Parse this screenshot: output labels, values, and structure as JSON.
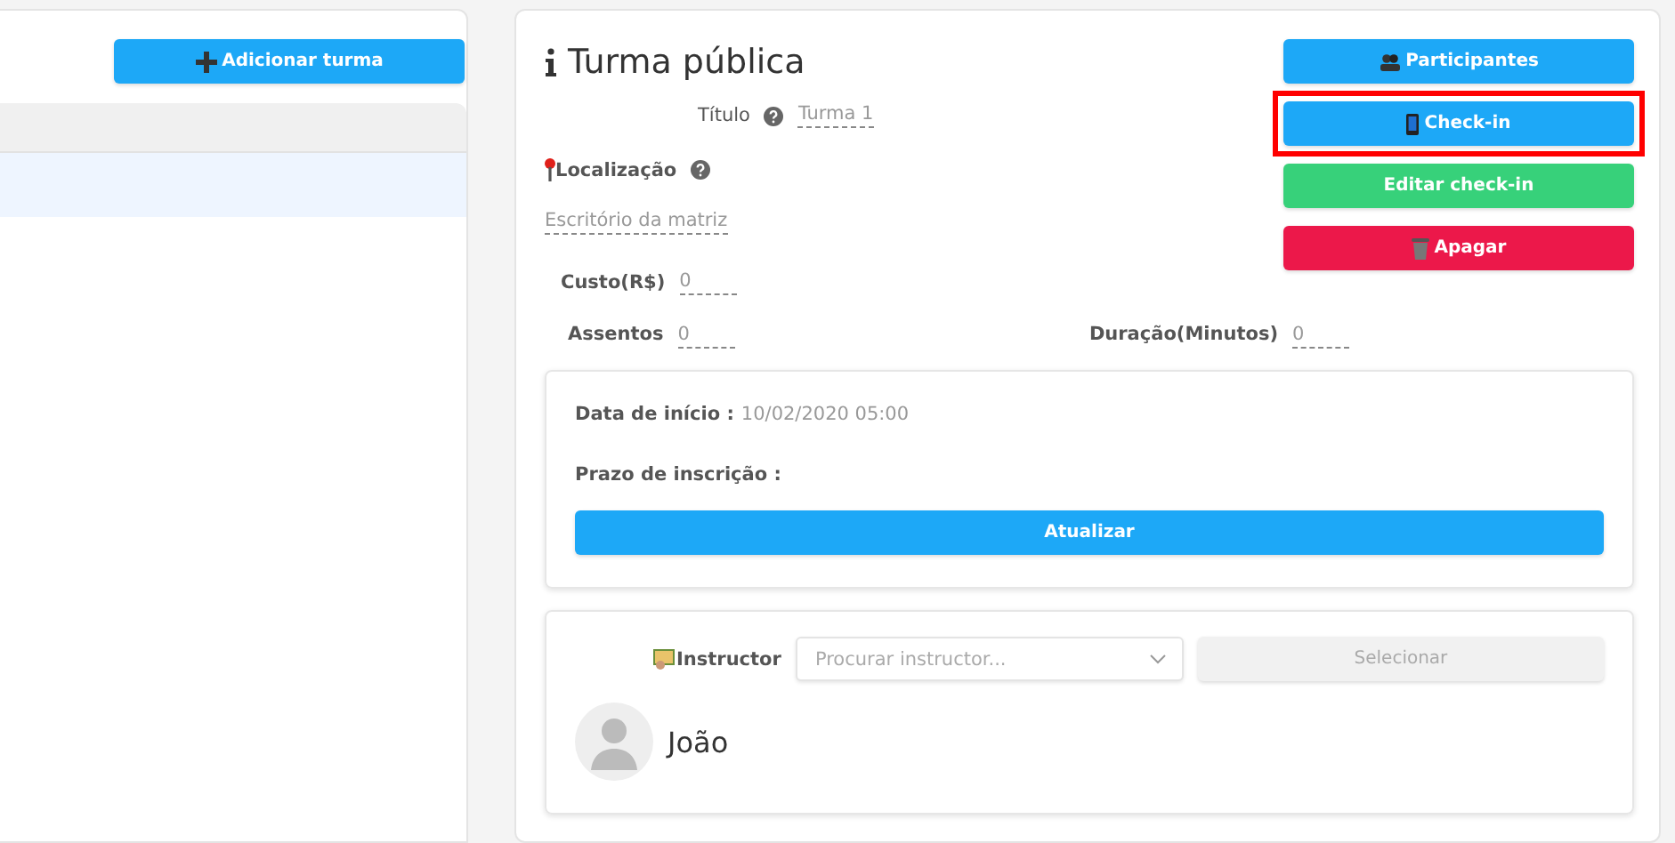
{
  "left_panel": {
    "add_button": "Adicionar turma",
    "rows": [
      {
        "selected": true
      }
    ]
  },
  "detail": {
    "title": "Turma pública",
    "title_field": {
      "label": "Título",
      "value": "Turma 1"
    },
    "location": {
      "label": "Localização",
      "value": "Escritório da matriz"
    },
    "cost": {
      "label": "Custo(R$)",
      "value": "0"
    },
    "seats": {
      "label": "Assentos",
      "value": "0"
    },
    "duration": {
      "label": "Duração(Minutos)",
      "value": "0"
    },
    "actions": [
      {
        "label": "Participantes",
        "kind": "primary",
        "highlighted": false
      },
      {
        "label": "Check-in",
        "kind": "primary",
        "highlighted": true
      },
      {
        "label": "Editar check-in",
        "kind": "success",
        "highlighted": false
      },
      {
        "label": "Apagar",
        "kind": "danger",
        "highlighted": false
      }
    ],
    "dates": {
      "start_label": "Data de início :",
      "start_value": "10/02/2020 05:00",
      "deadline_label": "Prazo de inscrição :",
      "update_button": "Atualizar"
    },
    "instructor": {
      "label": "Instructor",
      "placeholder": "Procurar instructor...",
      "select_button": "Selecionar",
      "select_disabled": true,
      "name": "João"
    }
  }
}
